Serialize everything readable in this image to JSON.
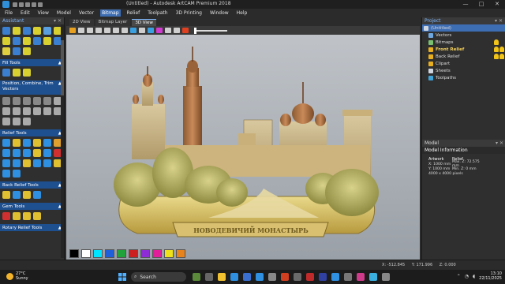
{
  "window": {
    "title": "(Untitled) - Autodesk ArtCAM Premium 2018",
    "controls": [
      "—",
      "□",
      "✕"
    ]
  },
  "menu": {
    "items": [
      "File",
      "Edit",
      "View",
      "Model",
      "Vector",
      "Bitmap",
      "Relief",
      "Toolpath",
      "3D Printing",
      "Window",
      "Help"
    ],
    "active_index": 5
  },
  "assistant": {
    "title": "Assistant",
    "sections": [
      {
        "label": "Fill Tools"
      },
      {
        "label": "Position, Combine, Trim Vectors"
      },
      {
        "label": "Relief Tools"
      },
      {
        "label": "Back Relief Tools"
      },
      {
        "label": "Gem Tools"
      },
      {
        "label": "Rotary Relief Tools"
      }
    ]
  },
  "viewport": {
    "tabs": [
      "2D View",
      "Bitmap Layer",
      "3D View"
    ],
    "active_tab": 2,
    "banner_text": "НОВОДЕВИЧИЙ МОНАСТЫРЬ"
  },
  "palette": {
    "colors": [
      "#000000",
      "#ffffff",
      "#00e5ff",
      "#1f5fd9",
      "#1fa33a",
      "#cc1f1f",
      "#8e2ad6",
      "#e11f9a",
      "#f0e21a",
      "#e8821a"
    ]
  },
  "status": {
    "x": "X: -512.845",
    "y": "Y: 171.996",
    "z": "Z: 0.000"
  },
  "project": {
    "title": "Project",
    "items": [
      {
        "label": "(Untitled)",
        "selected": true,
        "bold": false
      },
      {
        "label": "Vectors",
        "selected": false,
        "bold": false
      },
      {
        "label": "Bitmaps",
        "selected": false,
        "bold": false
      },
      {
        "label": "Front Relief",
        "selected": false,
        "bold": true
      },
      {
        "label": "Back Relief",
        "selected": false,
        "bold": false
      },
      {
        "label": "Clipart",
        "selected": false,
        "bold": false
      },
      {
        "label": "Sheets",
        "selected": false,
        "bold": false
      },
      {
        "label": "Toolpaths",
        "selected": false,
        "bold": false
      }
    ]
  },
  "model_panel": {
    "tab": "Model",
    "title": "Model Information",
    "artwork_label": "Artwork",
    "relief_label": "Relief",
    "x_size": "X: 1000 mm",
    "y_size": "Y: 1000 mm",
    "pixels": "4000 x 4000 pixels",
    "max_z": "Max. Z: 72.575 mm",
    "min_z": "Min. Z: 0 mm"
  },
  "taskbar": {
    "temperature": "27°C",
    "weather": "Sunny",
    "search_placeholder": "Search",
    "time": "13:10",
    "date": "22/11/2025"
  }
}
